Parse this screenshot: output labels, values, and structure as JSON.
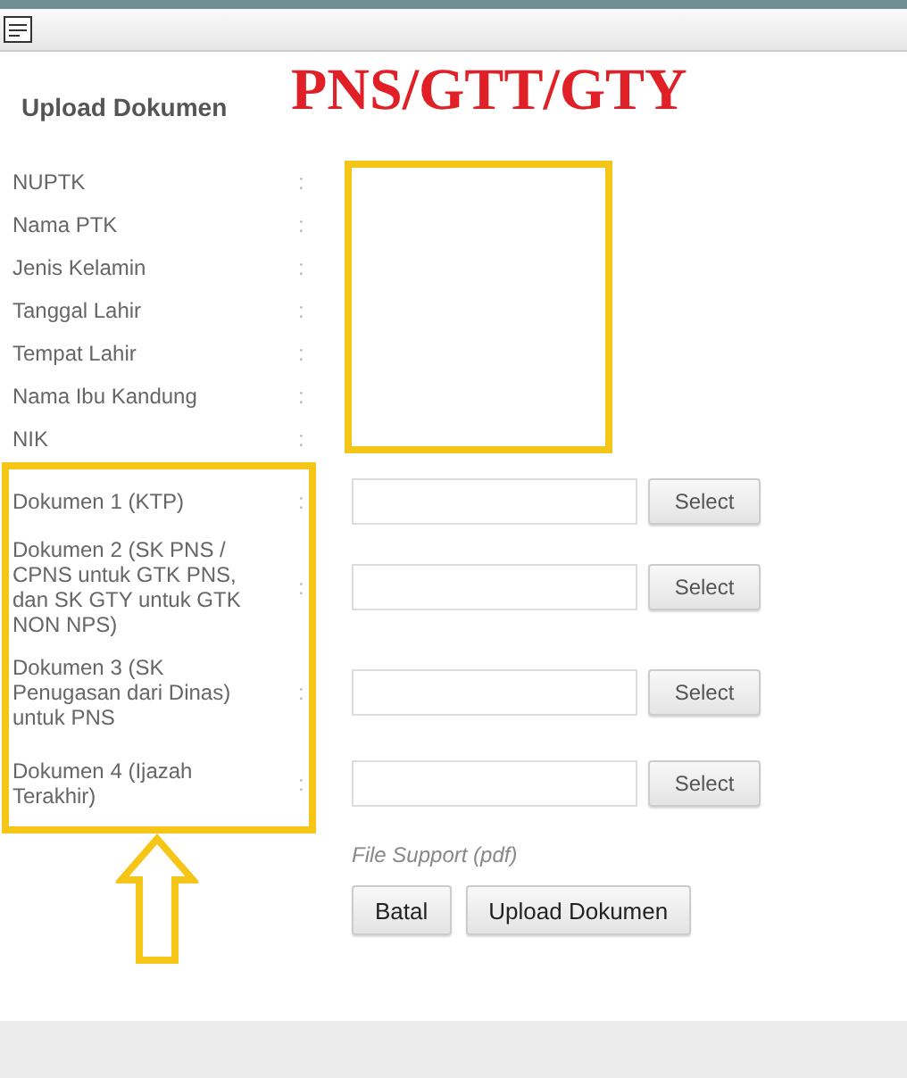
{
  "panel": {
    "title": "Upload Dokumen"
  },
  "annotation": {
    "headline": "PNS/GTT/GTY"
  },
  "info_fields": [
    {
      "label": "NUPTK",
      "separator": ":"
    },
    {
      "label": "Nama PTK",
      "separator": ":"
    },
    {
      "label": "Jenis Kelamin",
      "separator": ":"
    },
    {
      "label": "Tanggal Lahir",
      "separator": ":"
    },
    {
      "label": "Tempat Lahir",
      "separator": ":"
    },
    {
      "label": "Nama Ibu Kandung",
      "separator": ":"
    },
    {
      "label": "NIK",
      "separator": ":"
    }
  ],
  "documents": [
    {
      "label": "Dokumen 1 (KTP)",
      "separator": ":",
      "button": "Select"
    },
    {
      "label": "Dokumen 2 (SK PNS / CPNS untuk GTK PNS, dan SK GTY untuk GTK NON NPS)",
      "separator": ":",
      "button": "Select"
    },
    {
      "label": "Dokumen 3 (SK Penugasan dari Dinas) untuk PNS",
      "separator": ":",
      "button": "Select"
    },
    {
      "label": "Dokumen 4 (Ijazah Terakhir)",
      "separator": ":",
      "button": "Select"
    }
  ],
  "hint": "File Support (pdf)",
  "buttons": [
    "Batal",
    "Upload Dokumen"
  ]
}
